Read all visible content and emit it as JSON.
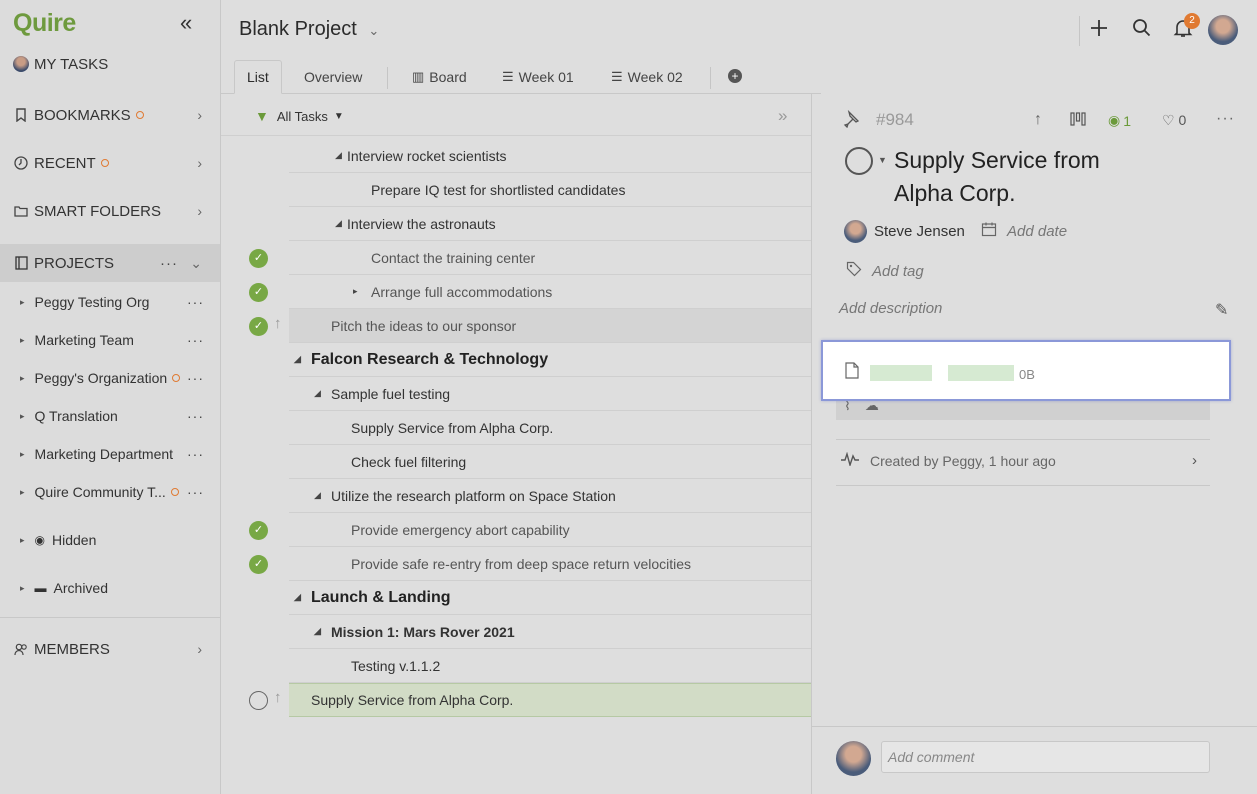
{
  "sidebar": {
    "logo": "Quire",
    "collapse_icon": "«",
    "my_tasks": "MY TASKS",
    "bookmarks": "BOOKMARKS",
    "recent": "RECENT",
    "smart_folders": "SMART FOLDERS",
    "projects": "PROJECTS",
    "projects_more": "···",
    "project_items": [
      {
        "label": "Peggy Testing Org",
        "more": "···"
      },
      {
        "label": "Marketing Team",
        "more": "···"
      },
      {
        "label": "Peggy's Organization",
        "more": "···"
      },
      {
        "label": "Q Translation",
        "more": "···"
      },
      {
        "label": "Marketing Department",
        "more": "···"
      },
      {
        "label": "Quire Community T...",
        "more": "···"
      }
    ],
    "hidden": "Hidden",
    "archived": "Archived",
    "members": "MEMBERS",
    "accent": "#6e9a3e",
    "notify_color": "#e07a32"
  },
  "header": {
    "project_title": "Blank Project",
    "notification_count": "2"
  },
  "tabs": {
    "list": "List",
    "overview": "Overview",
    "board": "Board",
    "week01": "Week 01",
    "week02": "Week 02"
  },
  "filter": {
    "label": "All Tasks"
  },
  "tasks": [
    {
      "text": "Interview rocket scientists"
    },
    {
      "text": "Prepare IQ test for shortlisted candidates"
    },
    {
      "text": "Interview the astronauts"
    },
    {
      "text": "Contact the training center"
    },
    {
      "text": "Arrange full accommodations"
    },
    {
      "text": "Pitch the ideas to our sponsor"
    },
    {
      "text": "Falcon Research & Technology"
    },
    {
      "text": "Sample fuel testing"
    },
    {
      "text": "Supply Service from Alpha Corp."
    },
    {
      "text": "Check fuel filtering"
    },
    {
      "text": "Utilize the research platform on Space Station"
    },
    {
      "text": "Provide emergency abort capability"
    },
    {
      "text": "Provide safe re-entry from deep space return velocities"
    },
    {
      "text": "Launch & Landing"
    },
    {
      "text": "Mission 1: Mars Rover 2021"
    },
    {
      "text": "Testing v.1.1.2"
    },
    {
      "text": "Supply Service from Alpha Corp."
    }
  ],
  "detail": {
    "task_id": "#984",
    "watch_count": "1",
    "like_count": "0",
    "title": "Supply Service from Alpha Corp.",
    "assignee": "Steve Jensen",
    "add_date": "Add date",
    "add_tag": "Add tag",
    "add_description": "Add description",
    "attachment_size": "0B",
    "created": "Created by Peggy, 1 hour ago",
    "add_comment": "Add comment"
  }
}
